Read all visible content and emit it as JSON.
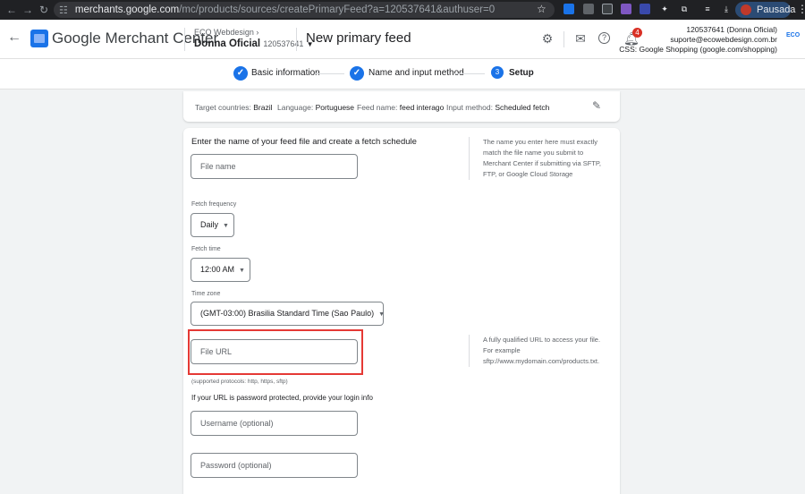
{
  "browser": {
    "url_host": "merchants.google.com",
    "url_path": "/mc/products/sources/createPrimaryFeed?a=120537641&authuser=0",
    "profile_label": "Pausada"
  },
  "header": {
    "app_name": "Google Merchant Center",
    "account_parent": "ECO Webdesign",
    "account_name": "Donna Oficial",
    "account_id": "120537641",
    "page_title": "New primary feed",
    "notification_count": "4",
    "account_right_line1": "120537641 (Donna Oficial)",
    "account_right_line2": "suporte@ecowebdesign.com.br",
    "account_right_line3": "CSS: Google Shopping (google.com/shopping)",
    "eco_logo_text": "ECO"
  },
  "stepper": {
    "steps": [
      {
        "label": "Basic information",
        "state": "done"
      },
      {
        "label": "Name and input method",
        "state": "done"
      },
      {
        "label": "Setup",
        "state": "current",
        "number": "3"
      }
    ]
  },
  "summary": {
    "target_label": "Target countries:",
    "target_value": "Brazil",
    "language_label": "Language:",
    "language_value": "Portuguese",
    "feed_label": "Feed name:",
    "feed_value": "feed interago",
    "input_label": "Input method:",
    "input_value": "Scheduled fetch"
  },
  "form": {
    "heading": "Enter the name of your feed file and create a fetch schedule",
    "file_name_help": "The name you enter here must exactly match the file name you submit to Merchant Center if submitting via SFTP, FTP, or Google Cloud Storage",
    "file_name_placeholder": "File name",
    "fetch_frequency_label": "Fetch frequency",
    "fetch_frequency_value": "Daily",
    "fetch_time_label": "Fetch time",
    "fetch_time_value": "12:00 AM",
    "time_zone_label": "Time zone",
    "time_zone_value": "(GMT-03:00) Brasilia Standard Time (Sao Paulo)",
    "file_url_placeholder": "File URL",
    "file_url_help": "A fully qualified URL to access your file. For example sftp://www.mydomain.com/products.txt.",
    "supported_protocols": "(supported protocols: http, https, sftp)",
    "password_heading": "If your URL is password protected, provide your login info",
    "username_placeholder": "Username (optional)",
    "password_placeholder": "Password (optional)"
  },
  "colors": {
    "accent": "#1a73e8",
    "highlight": "#e53935"
  }
}
